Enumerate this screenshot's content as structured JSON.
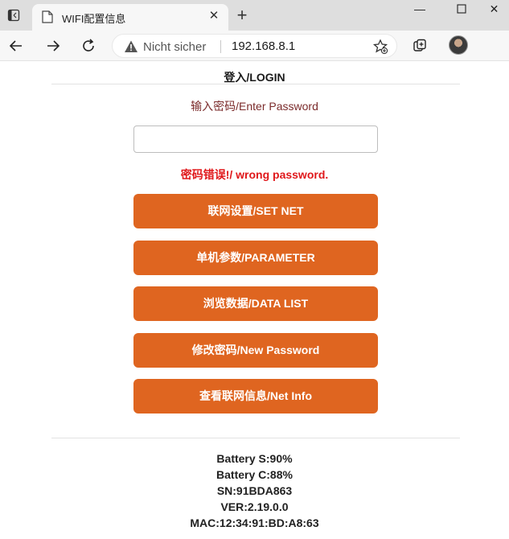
{
  "browser": {
    "tab_title": "WIFI配置信息",
    "address": {
      "security_text": "Nicht sicher",
      "url": "192.168.8.1"
    }
  },
  "page": {
    "login_title": "登入/LOGIN",
    "password_label": "输入密码/Enter Password",
    "password_value": "",
    "error_message": "密码错误!/ wrong password.",
    "buttons": [
      {
        "label": "联网设置/SET NET"
      },
      {
        "label": "单机参数/PARAMETER"
      },
      {
        "label": "浏览数据/DATA LIST"
      },
      {
        "label": "修改密码/New Password"
      },
      {
        "label": "查看联网信息/Net Info"
      }
    ],
    "info": {
      "battery_s": "Battery S:90%",
      "battery_c": "Battery C:88%",
      "sn": "SN:91BDA863",
      "ver": "VER:2.19.0.0",
      "mac": "MAC:12:34:91:BD:A8:63"
    }
  },
  "colors": {
    "button": "#df6520",
    "error": "#e0181b",
    "label": "#7b2b2b"
  }
}
